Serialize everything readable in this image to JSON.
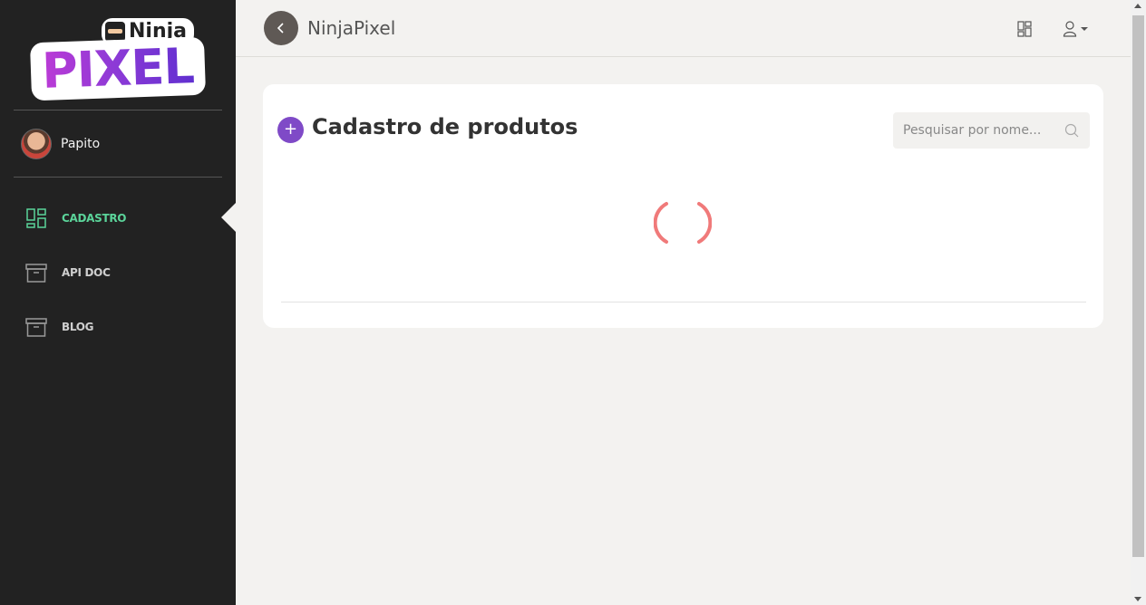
{
  "brand": {
    "logo_top": "Ninja",
    "logo_main": "PIXEL"
  },
  "sidebar": {
    "user_name": "Papito",
    "items": [
      {
        "label": "CADASTRO",
        "icon": "dashboard-icon",
        "active": true
      },
      {
        "label": "API DOC",
        "icon": "archive-box-icon",
        "active": false
      },
      {
        "label": "BLOG",
        "icon": "archive-box-icon",
        "active": false
      }
    ]
  },
  "header": {
    "title": "NinjaPixel"
  },
  "main": {
    "title": "Cadastro de produtos",
    "add_label": "+",
    "search": {
      "placeholder": "Pesquisar por nome...",
      "value": ""
    }
  },
  "colors": {
    "sidebar_bg": "#222222",
    "active_accent": "#5bd49a",
    "primary_button": "#7f4ac7",
    "spinner": "#f07a7a",
    "back_button": "#5f5955"
  }
}
